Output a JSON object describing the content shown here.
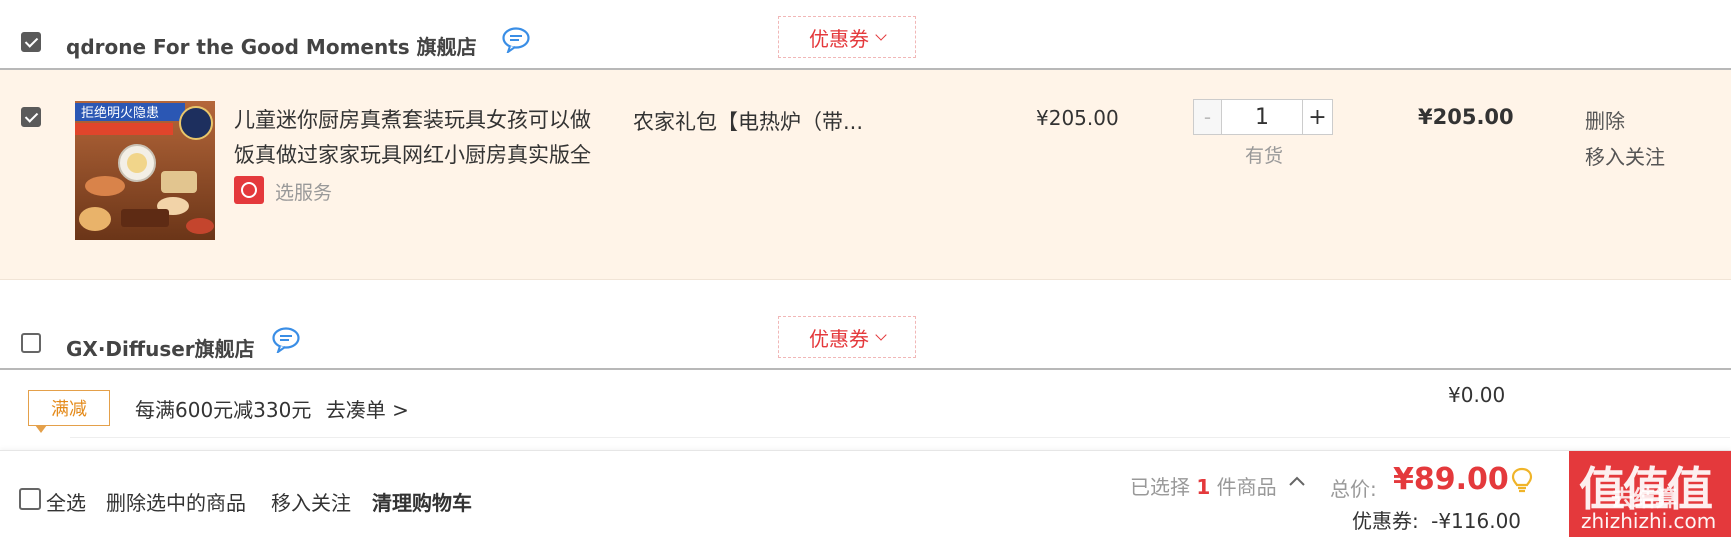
{
  "shop1": {
    "name": "qdrone For the Good Moments 旗舰店",
    "coupon_label": "优惠券",
    "checked": true
  },
  "item": {
    "checked": true,
    "title_line1": "儿童迷你厨房真煮套装玩具女孩可以做",
    "title_line2": "饭真做过家家玩具网红小厨房真实版全",
    "service_label": "选服务",
    "spec": "农家礼包【电热炉（带...",
    "unit_price": "¥205.00",
    "qty_minus": "-",
    "qty": "1",
    "qty_plus": "+",
    "stock": "有货",
    "subtotal": "¥205.00",
    "delete_label": "删除",
    "move_follow_label": "移入关注",
    "image_banner": "拒绝明火隐患"
  },
  "shop2": {
    "name": "GX·Diffuser旗舰店",
    "coupon_label": "优惠券",
    "checked": false
  },
  "promo": {
    "tag": "满减",
    "text": "每满600元减330元",
    "link": "去凑单 >",
    "price": "¥0.00"
  },
  "footer": {
    "select_all": "全选",
    "delete_selected": "删除选中的商品",
    "move_follow": "移入关注",
    "clear_cart": "清理购物车",
    "selected_prefix": "已选择",
    "selected_count": "1",
    "selected_suffix": "件商品",
    "total_label": "总价:",
    "total": "¥89.00",
    "coupon_label": "优惠券:",
    "coupon_value": "-¥116.00"
  },
  "watermark": {
    "main": "值值值",
    "overlay": "去结算",
    "sub": "zhizhizhi.com"
  },
  "colors": {
    "accent_red": "#e4393c",
    "row_highlight": "#fff4e8",
    "promo_orange": "#e48a1a"
  },
  "icons": {
    "chat": "chat-bubble-icon",
    "service": "service-gear-icon",
    "lightbulb": "lightbulb-icon",
    "chevron": "chevron-down-icon",
    "caret_up": "chevron-up-icon"
  }
}
